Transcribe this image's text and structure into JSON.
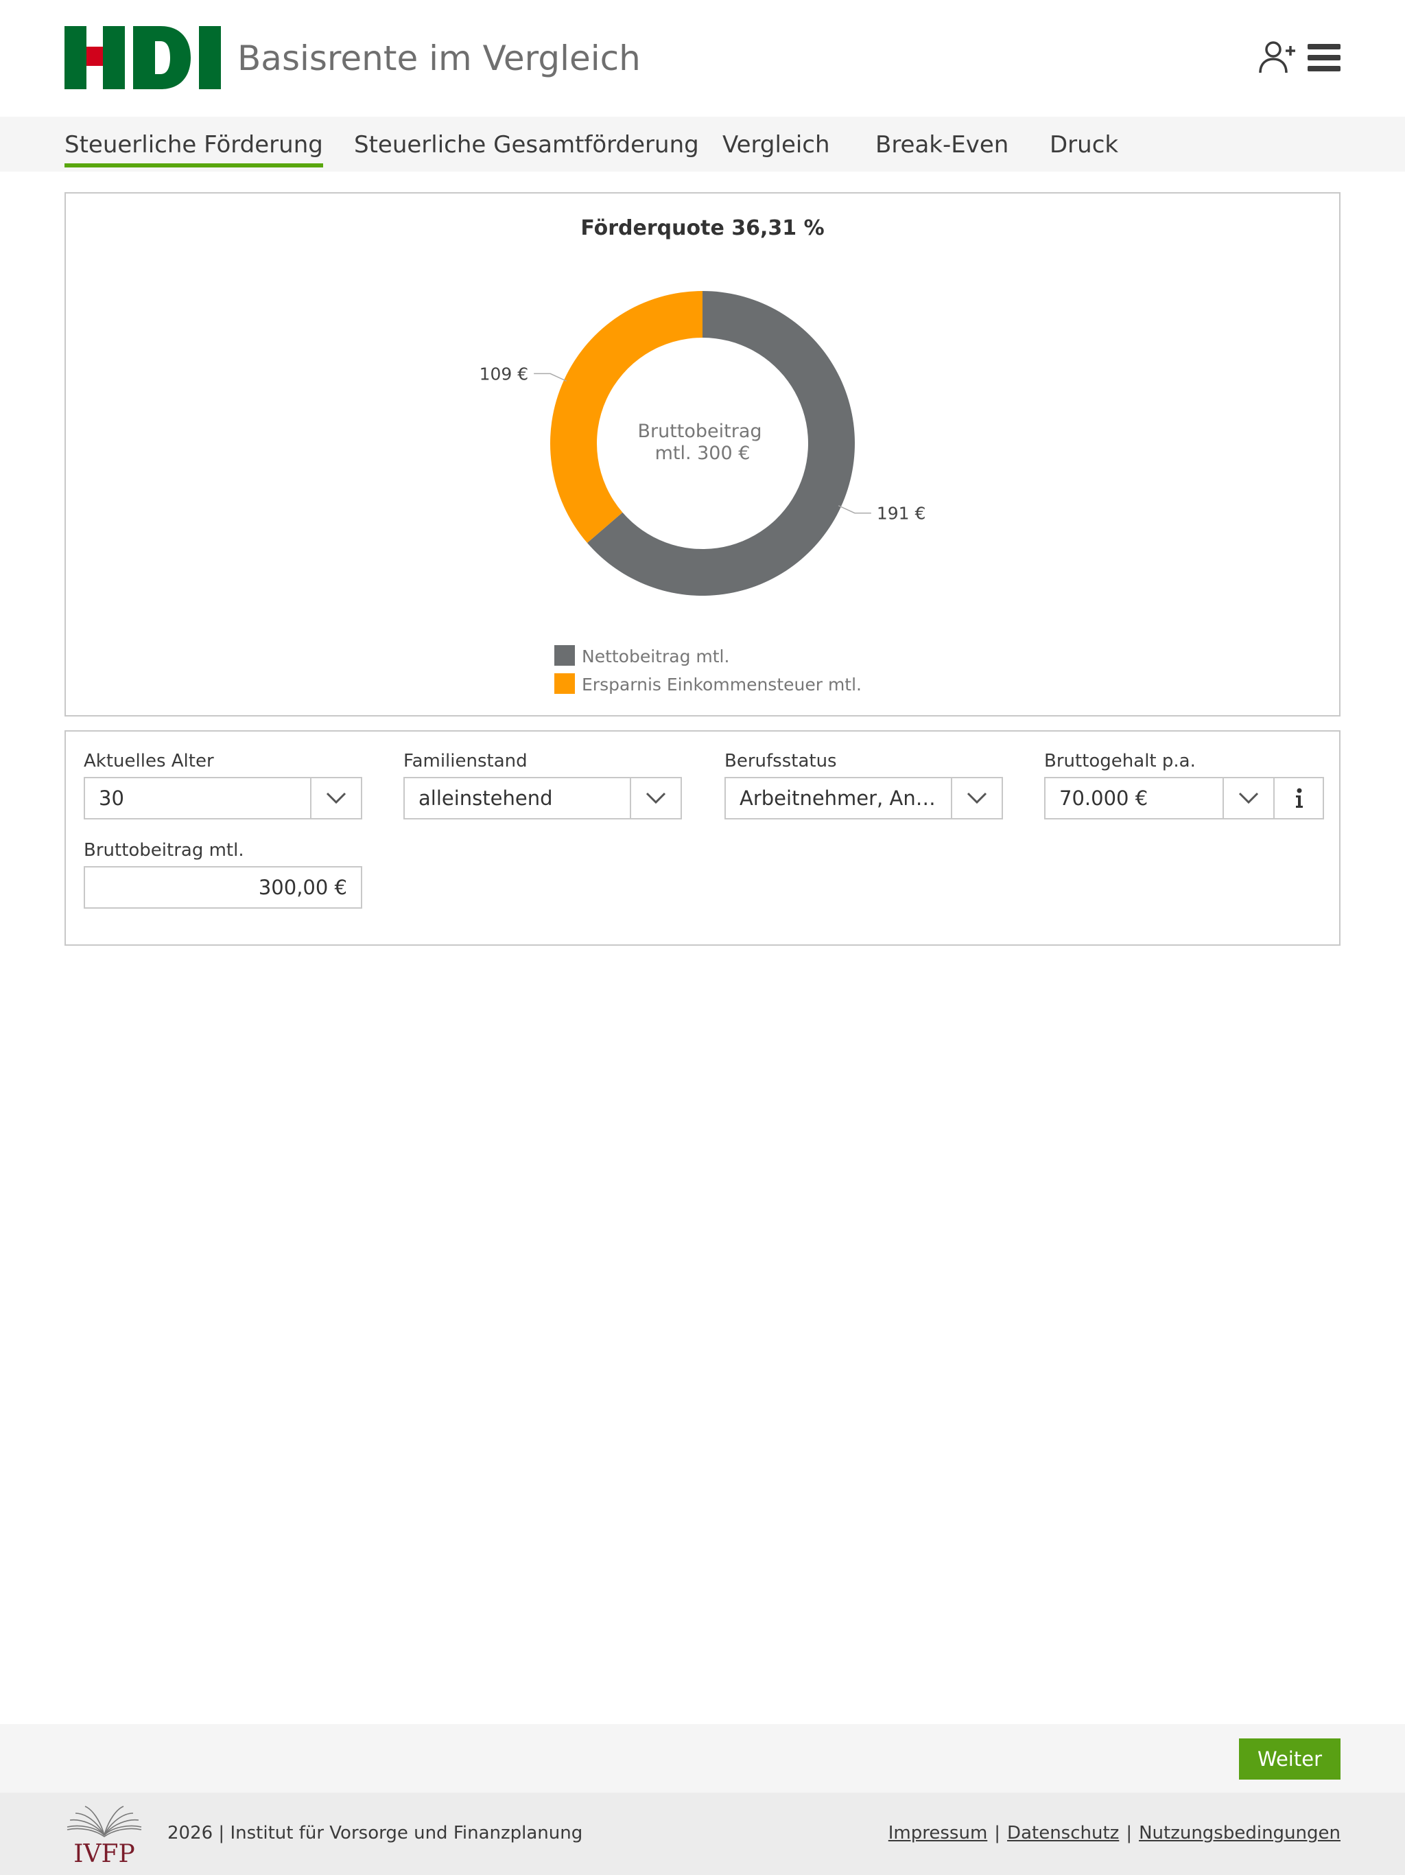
{
  "header": {
    "logo_text": "HDI",
    "title": "Basisrente im Vergleich",
    "icons": [
      "add-user-icon",
      "hamburger-menu-icon"
    ]
  },
  "tabs": [
    {
      "label": "Steuerliche Förderung",
      "active": true
    },
    {
      "label": "Steuerliche Gesamtförderung",
      "active": false
    },
    {
      "label": "Vergleich",
      "active": false
    },
    {
      "label": "Break-Even",
      "active": false
    },
    {
      "label": "Druck",
      "active": false
    }
  ],
  "chart_data": {
    "type": "pie",
    "title": "Förderquote 36,31 %",
    "center_label_line1": "Bruttobeitrag",
    "center_label_line2": "mtl. 300 €",
    "slices": [
      {
        "name": "Nettobeitrag mtl.",
        "value": 191,
        "label": "191 €",
        "color": "#6b6e70"
      },
      {
        "name": "Ersparnis Einkommensteuer mtl.",
        "value": 109,
        "label": "109 €",
        "color": "#ff9b00"
      }
    ],
    "legend_position": "bottom"
  },
  "form": {
    "alter": {
      "label": "Aktuelles Alter",
      "value": "30"
    },
    "familienstand": {
      "label": "Familienstand",
      "value": "alleinstehend"
    },
    "berufsstatus": {
      "label": "Berufsstatus",
      "value": "Arbeitnehmer, Ange..."
    },
    "bruttogehalt": {
      "label": "Bruttogehalt p.a.",
      "value": "70.000 €"
    },
    "bruttobeitrag": {
      "label": "Bruttobeitrag mtl.",
      "value": "300,00 €"
    }
  },
  "actions": {
    "weiter_label": "Weiter"
  },
  "footer": {
    "logo_text": "IVFP",
    "copyright": "2026 | Institut für Vorsorge und Finanzplanung",
    "links": [
      "Impressum",
      "Datenschutz",
      "Nutzungsbedingungen"
    ],
    "separator": "|"
  },
  "colors": {
    "brand_green": "#006b2d",
    "brand_red": "#d0021b",
    "accent_green": "#59a014",
    "slice_grey": "#6b6e70",
    "slice_orange": "#ff9b00"
  }
}
